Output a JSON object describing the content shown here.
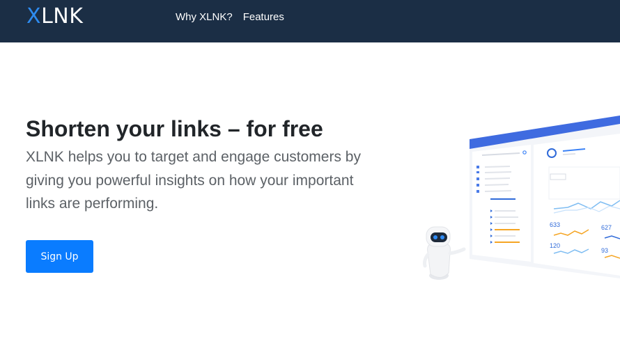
{
  "header": {
    "logo_x": "X",
    "logo_rest": "LNK",
    "nav": [
      {
        "label": "Why XLNK?"
      },
      {
        "label": "Features"
      }
    ]
  },
  "hero": {
    "title": "Shorten your links – for free",
    "description": "XLNK helps you to target and engage customers by giving you powerful insights on how your important links are performing.",
    "signup_label": "Sign Up"
  },
  "dashboard": {
    "stats": [
      "633",
      "627",
      "120",
      "93"
    ]
  },
  "colors": {
    "navbar": "#1b2e45",
    "accent": "#0a7cff",
    "logo_x": "#2e8cf0",
    "chart_blue": "#7fbdf2",
    "chart_orange": "#f5a524"
  }
}
